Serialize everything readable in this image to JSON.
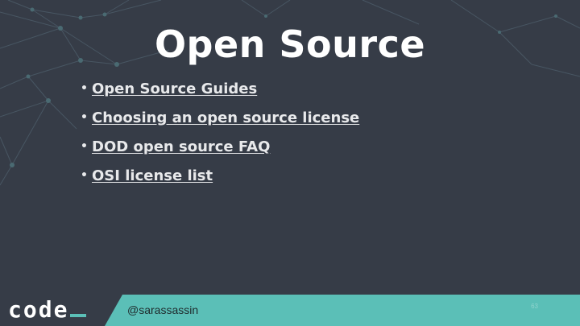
{
  "slide": {
    "title": "Open Source",
    "bullets": [
      {
        "label": "Open Source Guides"
      },
      {
        "label": "Choosing an open source license"
      },
      {
        "label": "DOD open source FAQ"
      },
      {
        "label": "OSI license list"
      }
    ]
  },
  "footer": {
    "logo_text": "code",
    "handle": "@sarassassin",
    "page_number": "63"
  },
  "colors": {
    "background": "#363c47",
    "accent": "#5bbfb7",
    "text": "#ffffff"
  },
  "icons": [
    "network-pattern",
    "bullet-dot",
    "code-logo"
  ]
}
